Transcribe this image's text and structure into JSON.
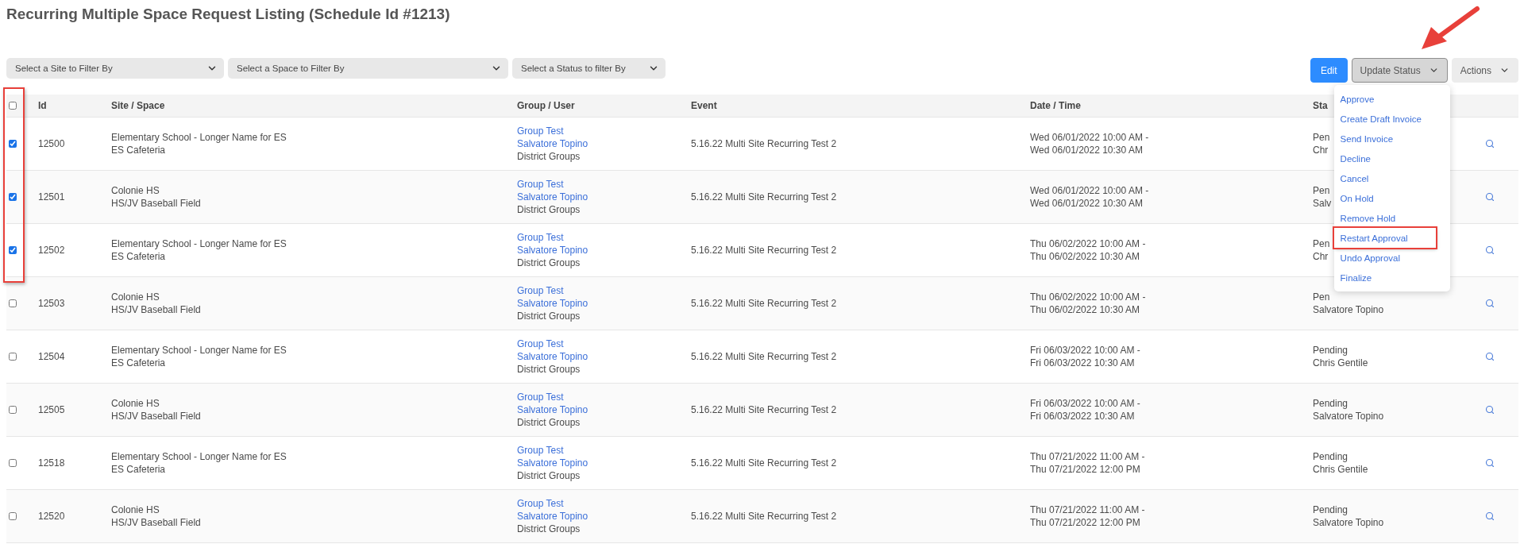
{
  "title": "Recurring Multiple Space Request Listing (Schedule Id #1213)",
  "filters": [
    {
      "label": "Select a Site to Filter By"
    },
    {
      "label": "Select a Space to Filter By"
    },
    {
      "label": "Select a Status to filter By"
    }
  ],
  "buttons": [
    {
      "label": "Edit",
      "kind": "primary"
    },
    {
      "label": "Update Status",
      "kind": "dropdown",
      "expanded": true
    },
    {
      "label": "Actions",
      "kind": "dropdown",
      "expanded": false
    }
  ],
  "status_menu": {
    "items": [
      {
        "label": "Approve",
        "annotated": false
      },
      {
        "label": "Create Draft Invoice",
        "annotated": false
      },
      {
        "label": "Send Invoice",
        "annotated": false
      },
      {
        "label": "Decline",
        "annotated": false
      },
      {
        "label": "Cancel",
        "annotated": false
      },
      {
        "label": "On Hold",
        "annotated": false
      },
      {
        "label": "Remove Hold",
        "annotated": false
      },
      {
        "label": "Restart Approval",
        "annotated": true
      },
      {
        "label": "Undo Approval",
        "annotated": false
      },
      {
        "label": "Finalize",
        "annotated": false
      }
    ]
  },
  "annotations": [
    {
      "kind": "arrow"
    }
  ],
  "table": {
    "select_all": {
      "checked": false
    },
    "checkbox_column_annotated": true,
    "columns": [
      "Id",
      "Site / Space",
      "Group / User",
      "Event",
      "Date / Time",
      "Sta"
    ],
    "rows": [
      {
        "checked": true,
        "id": "12500",
        "site": "Elementary School - Longer Name for ES",
        "space": "ES Cafeteria",
        "group": "Group Test",
        "user": "Salvatore Topino",
        "user_group": "District Groups",
        "event": "5.16.22 Multi Site Recurring Test 2",
        "start": "Wed 06/01/2022 10:00 AM -",
        "end": "Wed 06/01/2022 10:30 AM",
        "status": "Pen",
        "person": "Chr"
      },
      {
        "checked": true,
        "id": "12501",
        "site": "Colonie HS",
        "space": "HS/JV Baseball Field",
        "group": "Group Test",
        "user": "Salvatore Topino",
        "user_group": "District Groups",
        "event": "5.16.22 Multi Site Recurring Test 2",
        "start": "Wed 06/01/2022 10:00 AM -",
        "end": "Wed 06/01/2022 10:30 AM",
        "status": "Pen",
        "person": "Salv"
      },
      {
        "checked": true,
        "id": "12502",
        "site": "Elementary School - Longer Name for ES",
        "space": "ES Cafeteria",
        "group": "Group Test",
        "user": "Salvatore Topino",
        "user_group": "District Groups",
        "event": "5.16.22 Multi Site Recurring Test 2",
        "start": "Thu 06/02/2022 10:00 AM -",
        "end": "Thu 06/02/2022 10:30 AM",
        "status": "Pen",
        "person": "Chr"
      },
      {
        "checked": false,
        "id": "12503",
        "site": "Colonie HS",
        "space": "HS/JV Baseball Field",
        "group": "Group Test",
        "user": "Salvatore Topino",
        "user_group": "District Groups",
        "event": "5.16.22 Multi Site Recurring Test 2",
        "start": "Thu 06/02/2022 10:00 AM -",
        "end": "Thu 06/02/2022 10:30 AM",
        "status": "Pen",
        "person": "Salvatore Topino"
      },
      {
        "checked": false,
        "id": "12504",
        "site": "Elementary School - Longer Name for ES",
        "space": "ES Cafeteria",
        "group": "Group Test",
        "user": "Salvatore Topino",
        "user_group": "District Groups",
        "event": "5.16.22 Multi Site Recurring Test 2",
        "start": "Fri 06/03/2022 10:00 AM -",
        "end": "Fri 06/03/2022 10:30 AM",
        "status": "Pending",
        "person": "Chris Gentile"
      },
      {
        "checked": false,
        "id": "12505",
        "site": "Colonie HS",
        "space": "HS/JV Baseball Field",
        "group": "Group Test",
        "user": "Salvatore Topino",
        "user_group": "District Groups",
        "event": "5.16.22 Multi Site Recurring Test 2",
        "start": "Fri 06/03/2022 10:00 AM -",
        "end": "Fri 06/03/2022 10:30 AM",
        "status": "Pending",
        "person": "Salvatore Topino"
      },
      {
        "checked": false,
        "id": "12518",
        "site": "Elementary School - Longer Name for ES",
        "space": "ES Cafeteria",
        "group": "Group Test",
        "user": "Salvatore Topino",
        "user_group": "District Groups",
        "event": "5.16.22 Multi Site Recurring Test 2",
        "start": "Thu 07/21/2022 11:00 AM -",
        "end": "Thu 07/21/2022 12:00 PM",
        "status": "Pending",
        "person": "Chris Gentile"
      },
      {
        "checked": false,
        "id": "12520",
        "site": "Colonie HS",
        "space": "HS/JV Baseball Field",
        "group": "Group Test",
        "user": "Salvatore Topino",
        "user_group": "District Groups",
        "event": "5.16.22 Multi Site Recurring Test 2",
        "start": "Thu 07/21/2022 11:00 AM -",
        "end": "Thu 07/21/2022 12:00 PM",
        "status": "Pending",
        "person": "Salvatore Topino"
      }
    ]
  }
}
